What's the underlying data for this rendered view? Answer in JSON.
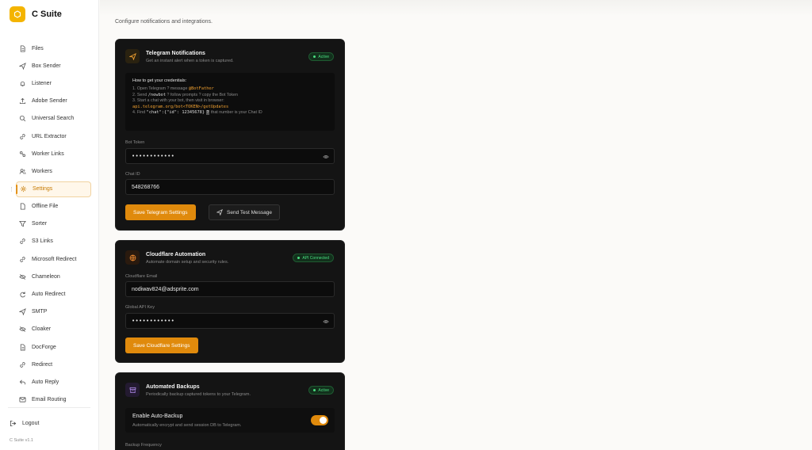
{
  "app": {
    "name": "C Suite",
    "version": "C Suite v1.1"
  },
  "sidebar": {
    "items": [
      {
        "label": "Files",
        "icon": "file-icon"
      },
      {
        "label": "Box Sender",
        "icon": "send-icon"
      },
      {
        "label": "Listener",
        "icon": "bell-icon"
      },
      {
        "label": "Adobe Sender",
        "icon": "upload-icon"
      },
      {
        "label": "Universal Search",
        "icon": "search-icon"
      },
      {
        "label": "URL Extractor",
        "icon": "link-icon"
      },
      {
        "label": "Worker Links",
        "icon": "workflow-icon"
      },
      {
        "label": "Workers",
        "icon": "users-icon"
      },
      {
        "label": "Settings",
        "icon": "gear-icon",
        "active": true
      },
      {
        "label": "Offline File",
        "icon": "file-icon"
      },
      {
        "label": "Sorter",
        "icon": "filter-icon"
      },
      {
        "label": "S3 Links",
        "icon": "link-icon"
      },
      {
        "label": "Microsoft Redirect",
        "icon": "link-icon"
      },
      {
        "label": "Chameleon",
        "icon": "eye-off-icon"
      },
      {
        "label": "Auto Redirect",
        "icon": "refresh-icon"
      },
      {
        "label": "SMTP",
        "icon": "send-icon"
      },
      {
        "label": "Cloaker",
        "icon": "eye-off-icon"
      },
      {
        "label": "DocForge",
        "icon": "file-icon"
      },
      {
        "label": "Redirect",
        "icon": "link-icon"
      },
      {
        "label": "Auto Reply",
        "icon": "reply-icon"
      },
      {
        "label": "Email Routing",
        "icon": "mail-icon"
      }
    ],
    "logout_label": "Logout"
  },
  "page": {
    "subtitle": "Configure notifications and integrations."
  },
  "telegram": {
    "title": "Telegram Notifications",
    "description": "Get an instant alert when a token is captured.",
    "status": "Active",
    "instructions": {
      "heading": "How to get your credentials:",
      "step1_prefix": "1. Open Telegram ? message ",
      "step1_code": "@BotFather",
      "step2_prefix": "2. Send ",
      "step2_code": "/newbot",
      "step2_suffix": " ? follow prompts ? copy the Bot Token",
      "step3_text": "3. Start a chat with your bot, then visit in browser:",
      "step3_code": "api.telegram.org/bot<TOKEN>/getUpdates",
      "step4_prefix": "4. Find ",
      "step4_code": "\"chat\":{\"id\": 12345678}",
      "step4_mark": "?",
      "step4_suffix": " that number is your Chat ID"
    },
    "bot_token_label": "Bot Token",
    "bot_token_value": "••••••••••••",
    "chat_id_label": "Chat ID",
    "chat_id_value": "548268766",
    "save_label": "Save Telegram Settings",
    "test_label": "Send Test Message"
  },
  "cloudflare": {
    "title": "Cloudflare Automation",
    "description": "Automate domain setup and security rules.",
    "status": "API Connected",
    "email_label": "Cloudflare Email",
    "email_value": "nodiwav824@adsprite.com",
    "api_key_label": "Global API Key",
    "api_key_value": "••••••••••••",
    "save_label": "Save Cloudflare Settings"
  },
  "backups": {
    "title": "Automated Backups",
    "description": "Periodically backup captured tokens to your Telegram.",
    "status": "Active",
    "toggle_title": "Enable Auto-Backup",
    "toggle_desc": "Automatically encrypt and send session DB to Telegram.",
    "toggle_on": true,
    "frequency_label": "Backup Frequency"
  },
  "colors": {
    "accent": "#e08a0c",
    "card_bg": "#141414",
    "success": "#4ade80",
    "logo": "#f4b400"
  }
}
